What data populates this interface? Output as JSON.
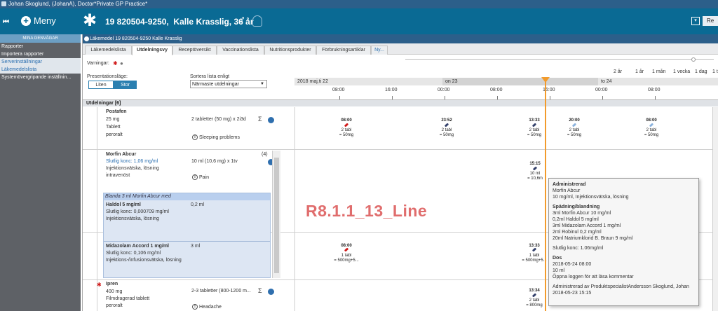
{
  "window": {
    "title": "Johan Skoglund, (JohanA), Doctor*Private GP Practice*"
  },
  "header": {
    "collapse_icon": "collapse-left-icon",
    "menu_label": "Meny",
    "patient_id": "19 820504-9250,",
    "patient_name": "Kalle Krasslig, 36 år",
    "sex_symbol": "♂",
    "dropdown_glyph": "▾",
    "right_button": "Re"
  },
  "sidebar": {
    "title": "MINA GENVÄGAR",
    "items": [
      {
        "label": "Rapporter"
      },
      {
        "label": "Importera rapporter"
      },
      {
        "label": "Serverinställningar"
      },
      {
        "label": "Läkemedelslista"
      },
      {
        "label": "Systemövergripande inställnin..."
      }
    ]
  },
  "panel": {
    "title": "Läkemedel 19 820504-9250 Kalle Krasslig"
  },
  "tabs": [
    {
      "label": "Läkemedelslista"
    },
    {
      "label": "Utdelningsvy"
    },
    {
      "label": "Receptöversikt"
    },
    {
      "label": "Vaccinationslista"
    },
    {
      "label": "Nutritionsprodukter"
    },
    {
      "label": "Förbrukningsartiklar"
    },
    {
      "label": "Ny..."
    }
  ],
  "controls": {
    "warnings_label": "Varningar:",
    "presentation_label": "Presentationsläge:",
    "small_label": "Liten",
    "large_label": "Stor",
    "sort_label": "Sortera lista enligt",
    "sort_value": "Närmaste utdelningar"
  },
  "timeline": {
    "zoom_options": [
      "2 år",
      "1 år",
      "1 mån",
      "1 vecka",
      "1 dag",
      "1 t"
    ],
    "dates": [
      "2018 maj,ti 22",
      "on 23",
      "to 24"
    ],
    "hours": [
      "08:00",
      "16:00",
      "00:00",
      "08:00",
      "16:00",
      "00:00",
      "08:00"
    ]
  },
  "section": {
    "title": "Utdelningar [6]"
  },
  "rows": {
    "postafen": {
      "name": "Postafen",
      "strength": "25 mg",
      "form": "Tablett",
      "route": "peroralt",
      "dose": "2 tabletter (50 mg) x 2i3d",
      "reason": "Sleeping problems",
      "events": [
        {
          "time": "08:00",
          "amount": "2 tabl",
          "dose": "= 50mg"
        },
        {
          "time": "23:52",
          "amount": "2 tabl",
          "dose": "= 50mg"
        },
        {
          "time": "13:33",
          "amount": "2 tabl",
          "dose": "= 50mg"
        },
        {
          "time": "20:00",
          "amount": "2 tabl",
          "dose": "= 50mg"
        },
        {
          "time": "08:00",
          "amount": "2 tabl",
          "dose": "= 50mg"
        }
      ]
    },
    "morfin": {
      "name": "Morfin Abcur",
      "count": "(4)",
      "conc": "Slutlig konc: 1,06 mg/ml",
      "form": "Injektionsvätska, lösning",
      "route": "intravenöst",
      "dose": "10 ml  (10,6 mg) x 1tv",
      "reason": "Pain",
      "event": {
        "time": "15:15",
        "amount": "10 ml",
        "dose": "= 10,6m"
      }
    },
    "mix": {
      "title": "Blanda 3 ml Morfin Abcur med",
      "items": [
        {
          "name": "Haldol 5 mg/ml",
          "amount": "0,2 ml",
          "conc": "Slutlig konc: 0,000709 mg/ml",
          "form": "Injektionsvätska, lösning"
        },
        {
          "name": "Midazolam Accord 1 mg/ml",
          "amount": "3 ml",
          "conc": "Slutlig konc: 0,106 mg/ml",
          "form": "Injektions-/infusionsvätska, lösning"
        }
      ]
    },
    "row3_events": [
      {
        "time": "08:00",
        "amount": "1 tabl",
        "dose": "= 500mg+5..."
      },
      {
        "time": "13:33",
        "amount": "1 tabl",
        "dose": "= 500mg+5..."
      }
    ],
    "ipren": {
      "name": "Ipren",
      "strength": "400 mg",
      "form": "Filmdragerad tablett",
      "route": "peroralt",
      "dose": "2-3 tabletter  (800-1200 m...",
      "reason": "Headache",
      "event": {
        "time": "13:34",
        "amount": "2 tabl",
        "dose": "= 800mg"
      }
    }
  },
  "tooltip": {
    "lines": [
      {
        "text": "Administrerad",
        "bold": true
      },
      {
        "text": "Morfin Abcur",
        "bold": false
      },
      {
        "text": "10 mg/ml, Injektionsvätska, lösning",
        "bold": false
      },
      {
        "text": "",
        "bold": false
      },
      {
        "text": "Spädning/blandning",
        "bold": true
      },
      {
        "text": "3ml Morfin Abcur 10 mg/ml",
        "bold": false
      },
      {
        "text": "0,2ml Haldol 5 mg/ml",
        "bold": false
      },
      {
        "text": "3ml Midazolam Accord 1 mg/ml",
        "bold": false
      },
      {
        "text": "2ml Robinul 0,2 mg/ml",
        "bold": false
      },
      {
        "text": "20ml Natriumklorid B. Braun 9 mg/ml",
        "bold": false
      },
      {
        "text": "",
        "bold": false
      },
      {
        "text": "Slutlig konc: 1.06mg/ml",
        "bold": false
      },
      {
        "text": "",
        "bold": false
      },
      {
        "text": "Dos",
        "bold": true
      },
      {
        "text": "2018-05-24 08:00",
        "bold": false
      },
      {
        "text": "10 ml",
        "bold": false
      },
      {
        "text": "Öppna loggen för att läsa kommentar",
        "bold": false
      },
      {
        "text": "",
        "bold": false
      },
      {
        "text": "Administrerad av ProduktspecialistAndersson Skoglund, Johan",
        "bold": false
      },
      {
        "text": "2018-05-23 15:15",
        "bold": false
      }
    ]
  },
  "watermark": "R8.1.1_13_Line",
  "colors": {
    "header": "#0a6a94",
    "accent": "#f29b2c",
    "alert": "#d01818"
  }
}
